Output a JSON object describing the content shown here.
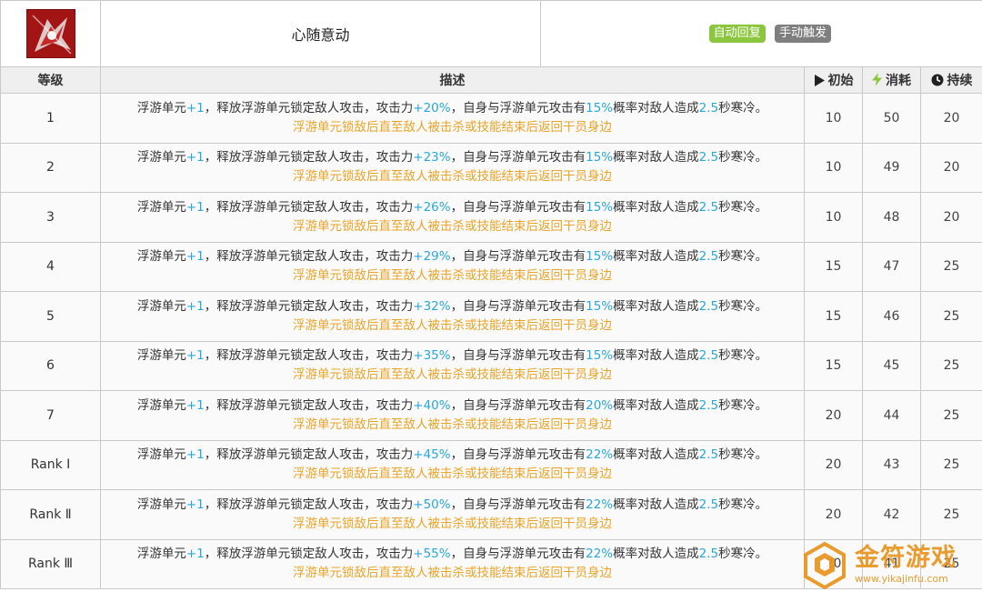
{
  "skill": {
    "name": "心随意动",
    "tags": {
      "auto": "自动回复",
      "manual": "手动触发"
    }
  },
  "headers": {
    "level": "等级",
    "description": "描述",
    "initial": "初始",
    "cost": "消耗",
    "duration": "持续"
  },
  "desc_parts": {
    "p1": "浮游单元",
    "p2": "，释放浮游单元锁定敌人攻击，攻击力",
    "p3": "，自身与浮游单元攻击有",
    "p4": "概率对敌人造成",
    "p5": "秒寒冷。",
    "note": "浮游单元锁敌后直至敌人被击杀或技能结束后返回干员身边"
  },
  "rows": [
    {
      "level": "1",
      "units": "+1",
      "atk": "+20%",
      "chance": "15%",
      "seconds": "2.5",
      "initial": "10",
      "cost": "50",
      "duration": "20"
    },
    {
      "level": "2",
      "units": "+1",
      "atk": "+23%",
      "chance": "15%",
      "seconds": "2.5",
      "initial": "10",
      "cost": "49",
      "duration": "20"
    },
    {
      "level": "3",
      "units": "+1",
      "atk": "+26%",
      "chance": "15%",
      "seconds": "2.5",
      "initial": "10",
      "cost": "48",
      "duration": "20"
    },
    {
      "level": "4",
      "units": "+1",
      "atk": "+29%",
      "chance": "15%",
      "seconds": "2.5",
      "initial": "15",
      "cost": "47",
      "duration": "25"
    },
    {
      "level": "5",
      "units": "+1",
      "atk": "+32%",
      "chance": "15%",
      "seconds": "2.5",
      "initial": "15",
      "cost": "46",
      "duration": "25"
    },
    {
      "level": "6",
      "units": "+1",
      "atk": "+35%",
      "chance": "15%",
      "seconds": "2.5",
      "initial": "15",
      "cost": "45",
      "duration": "25"
    },
    {
      "level": "7",
      "units": "+1",
      "atk": "+40%",
      "chance": "20%",
      "seconds": "2.5",
      "initial": "20",
      "cost": "44",
      "duration": "25"
    },
    {
      "level": "Rank Ⅰ",
      "units": "+1",
      "atk": "+45%",
      "chance": "22%",
      "seconds": "2.5",
      "initial": "20",
      "cost": "43",
      "duration": "25"
    },
    {
      "level": "Rank Ⅱ",
      "units": "+1",
      "atk": "+50%",
      "chance": "22%",
      "seconds": "2.5",
      "initial": "20",
      "cost": "42",
      "duration": "25"
    },
    {
      "level": "Rank Ⅲ",
      "units": "+1",
      "atk": "+55%",
      "chance": "22%",
      "seconds": "2.5",
      "initial": "20",
      "cost": "41",
      "duration": "25"
    }
  ],
  "watermark": {
    "title": "金符游戏",
    "url": "www.yikajinfu.com"
  },
  "colors": {
    "highlight": "#2aa7d8",
    "note": "#e9a427",
    "auto_tag": "#8cc63f",
    "manual_tag": "#7f7f7f",
    "header_bg": "#efefef"
  }
}
